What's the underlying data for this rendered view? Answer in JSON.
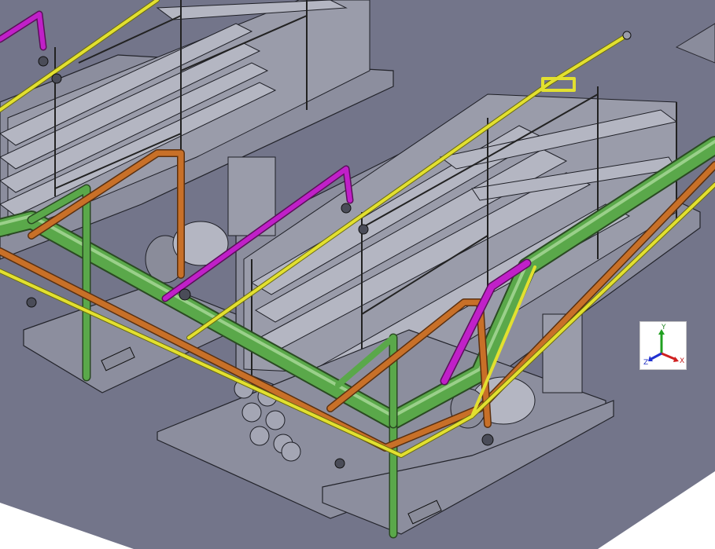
{
  "viewport": {
    "content": "cad-3d-piping-model",
    "background_color": "#5f6170",
    "floor_color": "#7a7c8c",
    "pipe_colors": {
      "green_line": "#5aa84a",
      "orange_line": "#c87028",
      "yellow_line": "#e2e030",
      "magenta_line": "#c020c8"
    }
  },
  "triad": {
    "label_y": "Y",
    "label_x": "X",
    "label_z": "Z",
    "axis_colors": {
      "x": "#d02020",
      "y": "#20a020",
      "z": "#2030d0"
    }
  }
}
